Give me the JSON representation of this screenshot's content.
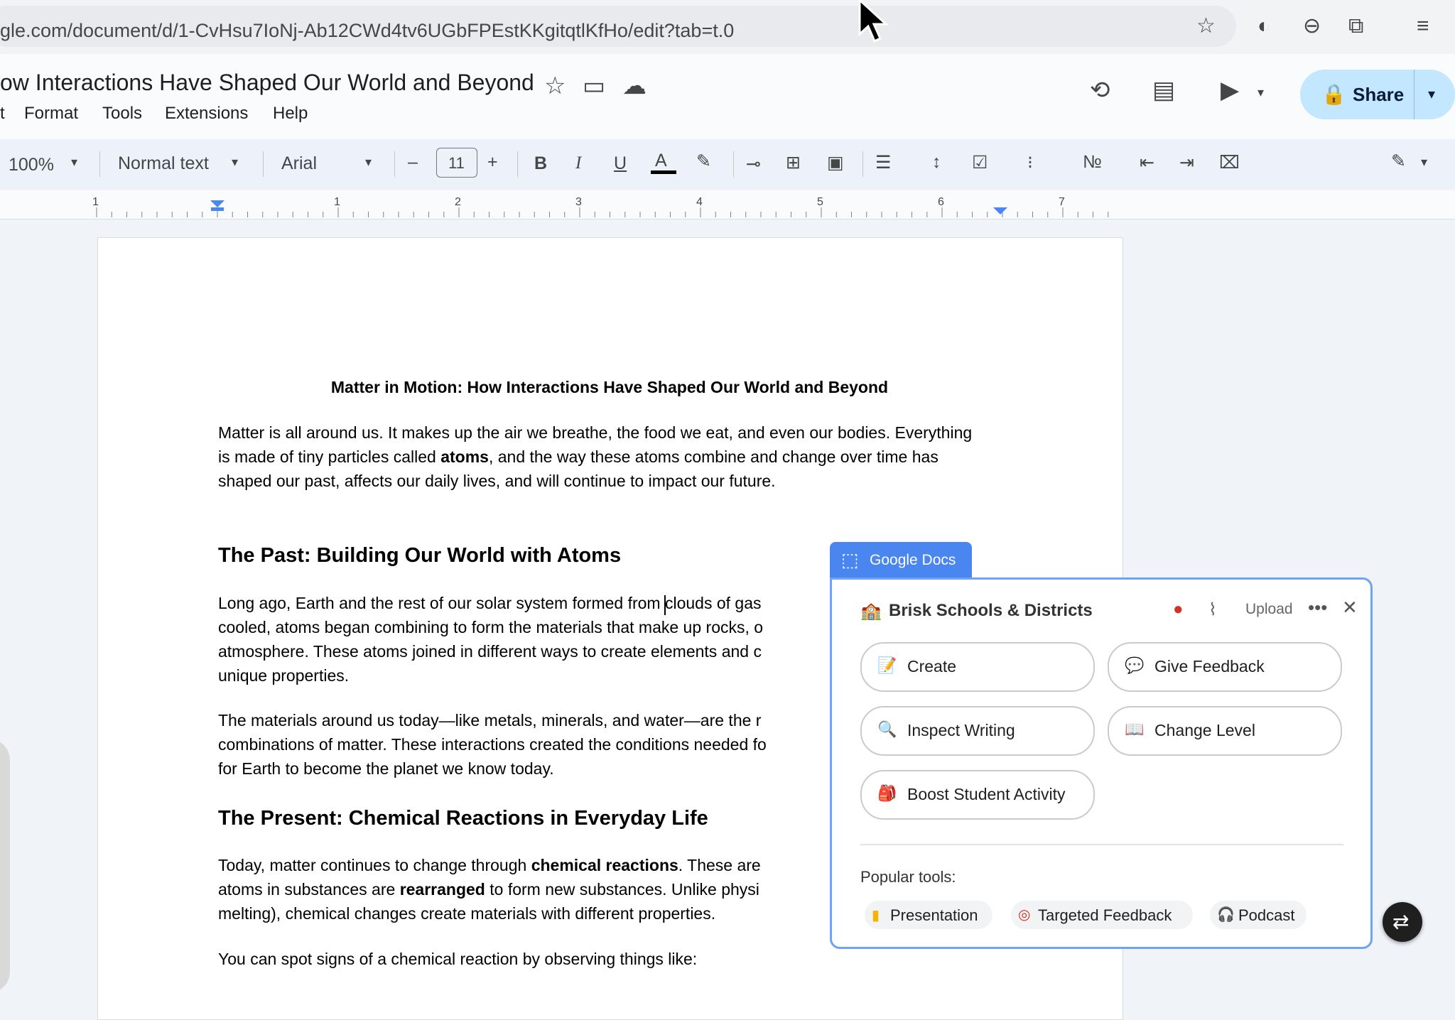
{
  "browser": {
    "url": "gle.com/document/d/1-CvHsu7IoNj-Ab12CWd4tv6UGbFPEstKKgitqtlKfHo/edit?tab=t.0"
  },
  "docs": {
    "title": "ow Interactions Have Shaped Our World and Beyond",
    "menu": [
      "t",
      "Format",
      "Tools",
      "Extensions",
      "Help"
    ],
    "share_label": "Share"
  },
  "toolbar": {
    "zoom": "100%",
    "style": "Normal text",
    "font": "Arial",
    "font_size": "11",
    "minus": "–",
    "plus": "+"
  },
  "ruler": {
    "numbers": [
      "1",
      "1",
      "2",
      "3",
      "4",
      "5",
      "6",
      "7"
    ]
  },
  "document": {
    "heading": "Matter in Motion: How Interactions Have Shaped Our World and Beyond",
    "intro": [
      {
        "text": "Matter is all around us. It makes up the air we breathe, the food we eat, and even our bodies. Everything is made of tiny particles called ",
        "bold": false
      },
      {
        "text": "atoms",
        "bold": true
      },
      {
        "text": ", and the way these atoms combine and change over time has shaped our past, affects our daily lives, and will continue to impact our future.",
        "bold": false
      }
    ],
    "h_past": "The Past: Building Our World with Atoms",
    "past_p1_lines": [
      "Long ago, Earth and the rest of our solar system formed from clouds of gas",
      "cooled, atoms began combining to form the materials that make up rocks, o",
      "atmosphere. These atoms joined in different ways to create elements and c",
      "unique properties."
    ],
    "past_p2_lines": [
      "The materials around us today—like metals, minerals, and water—are the r",
      "combinations of matter. These interactions created the conditions needed fo",
      "for Earth to become the planet we know today."
    ],
    "h_present": "The Present: Chemical Reactions in Everyday Life",
    "present_l1_a": "Today, matter continues to change through ",
    "present_l1_b": "chemical reactions",
    "present_l1_c": ". These are",
    "present_l2_a": "atoms in substances are ",
    "present_l2_b": "rearranged",
    "present_l2_c": " to form new substances. Unlike physi",
    "present_l3": "melting), chemical changes create materials with different properties.",
    "signs": "You can spot signs of a chemical reaction by observing things like:"
  },
  "brisk": {
    "tab_label": "Google Docs",
    "org": "Brisk Schools & Districts",
    "upload": "Upload",
    "buttons": {
      "create": "Create",
      "feedback": "Give Feedback",
      "inspect": "Inspect Writing",
      "level": "Change Level",
      "boost": "Boost Student Activity"
    },
    "popular_label": "Popular tools:",
    "popular": [
      "Presentation",
      "Targeted Feedback",
      "Podcast"
    ]
  },
  "colors": {
    "accent": "#4a86f0",
    "share_bg": "#c2e7ff",
    "page_bg": "#ffffff"
  }
}
